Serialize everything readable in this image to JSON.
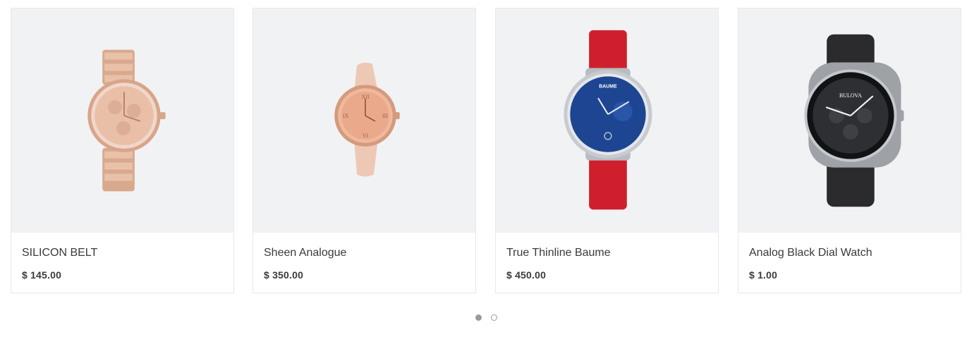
{
  "products": [
    {
      "name": "SILICON BELT",
      "price": "$ 145.00",
      "image_icon": "rose-gold-bracelet-watch"
    },
    {
      "name": "Sheen Analogue",
      "price": "$ 350.00",
      "image_icon": "rose-gold-leather-watch"
    },
    {
      "name": "True Thinline Baume",
      "price": "$ 450.00",
      "image_icon": "blue-dial-red-strap-watch",
      "dial_text": "BAUME"
    },
    {
      "name": "Analog Black Dial Watch",
      "price": "$ 1.00",
      "image_icon": "black-chronograph-watch",
      "dial_text": "BULOVA"
    }
  ],
  "carousel": {
    "pages": 2,
    "active_page": 1
  },
  "colors": {
    "image_bg": "#f1f2f4",
    "text": "#3a3a3a",
    "border": "#e8e8e8",
    "dot": "#9a9a9a"
  }
}
